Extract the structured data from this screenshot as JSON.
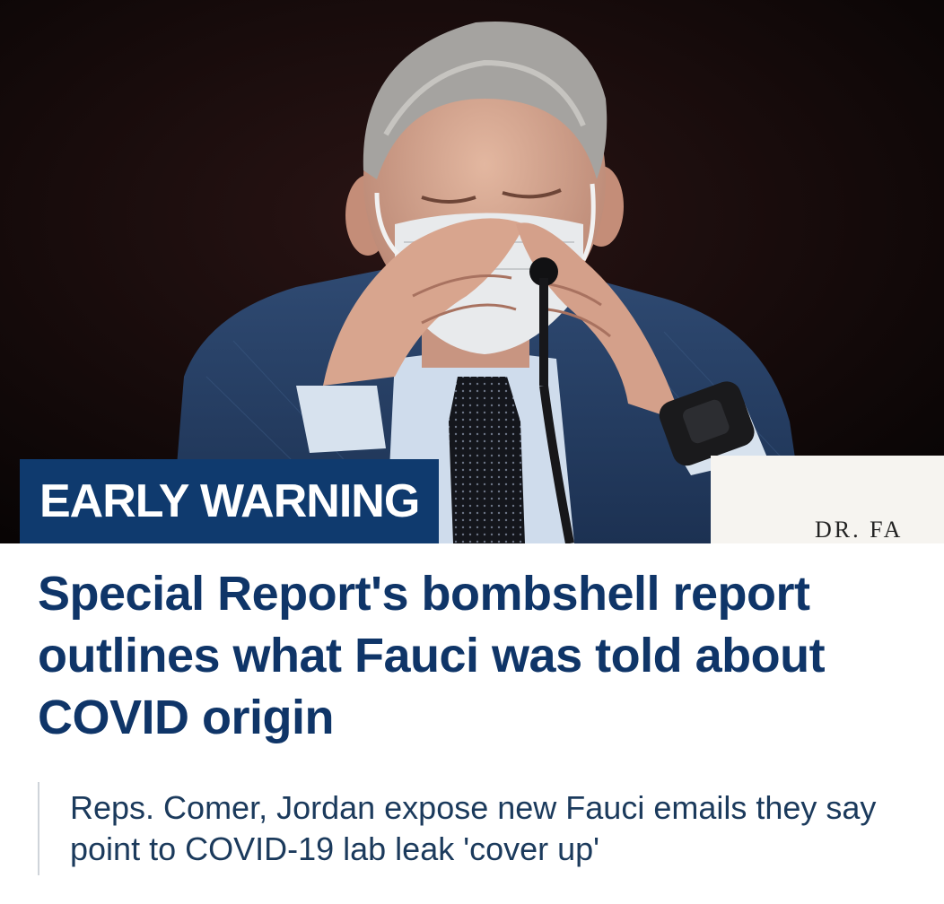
{
  "article": {
    "badge": "EARLY WARNING",
    "headline": "Special Report's bombshell report outlines what Fauci was told about COVID origin",
    "image_nameplate": "DR. FA",
    "related_link": "Reps. Comer, Jordan expose new Fauci emails they say point to COVID-19 lab leak 'cover up'"
  },
  "colors": {
    "badge_bg": "#0f3a6e",
    "headline": "#0f3568",
    "related_text": "#1b3a5c",
    "related_border": "#cfd4da"
  }
}
